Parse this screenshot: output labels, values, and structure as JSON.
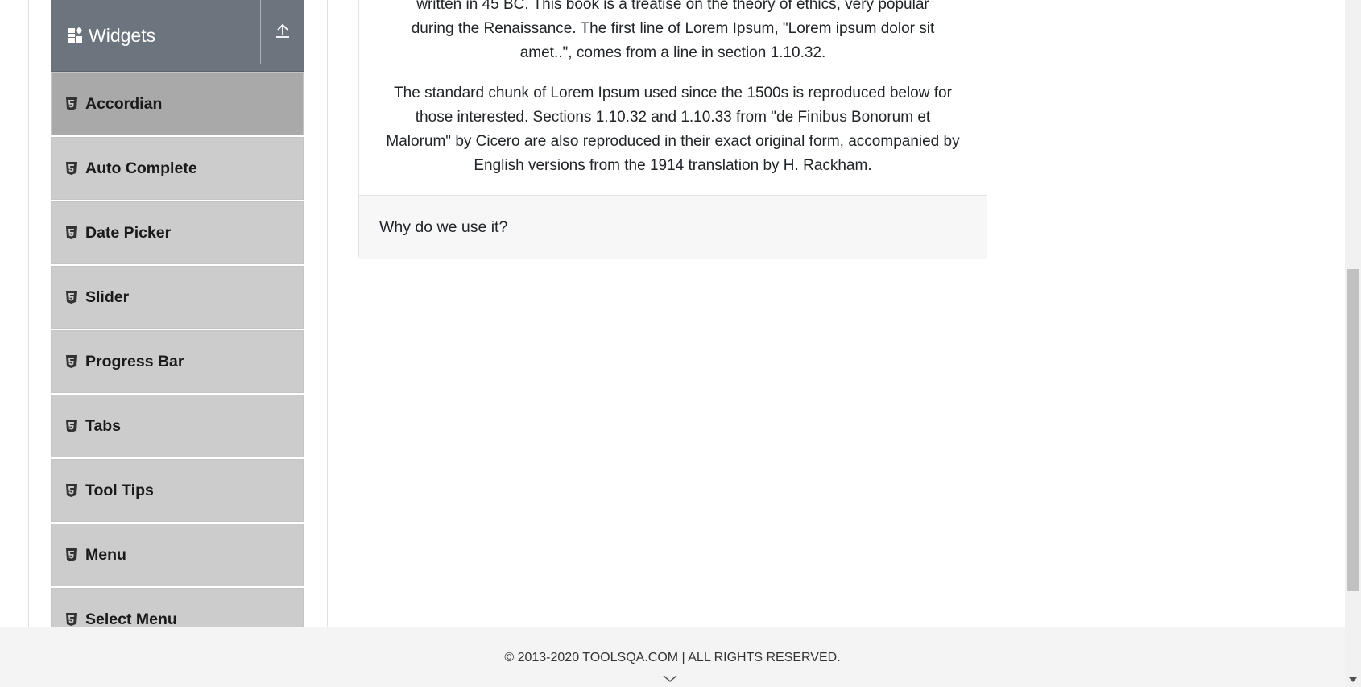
{
  "sidebar": {
    "group_title": "Widgets",
    "group_icon": "widgets-grid-icon",
    "collapse_icon": "upload-arrow-icon",
    "items": [
      {
        "label": "Accordian",
        "icon": "html5-icon",
        "active": true
      },
      {
        "label": "Auto Complete",
        "icon": "html5-icon",
        "active": false
      },
      {
        "label": "Date Picker",
        "icon": "html5-icon",
        "active": false
      },
      {
        "label": "Slider",
        "icon": "html5-icon",
        "active": false
      },
      {
        "label": "Progress Bar",
        "icon": "html5-icon",
        "active": false
      },
      {
        "label": "Tabs",
        "icon": "html5-icon",
        "active": false
      },
      {
        "label": "Tool Tips",
        "icon": "html5-icon",
        "active": false
      },
      {
        "label": "Menu",
        "icon": "html5-icon",
        "active": false
      },
      {
        "label": "Select Menu",
        "icon": "html5-icon",
        "active": false
      }
    ]
  },
  "accordion": {
    "paragraph_1_lines": [
      "written in 45 BC. This book is a treatise on the theory of ethics, very popular",
      "during the Renaissance. The first line of Lorem Ipsum, \"Lorem ipsum dolor sit",
      "amet..\", comes from a line in section 1.10.32."
    ],
    "paragraph_2": "The standard chunk of Lorem Ipsum used since the 1500s is reproduced below for those interested. Sections 1.10.32 and 1.10.33 from \"de Finibus Bonorum et Malorum\" by Cicero are also reproduced in their exact original form, accompanied by English versions from the 1914 translation by H. Rackham.",
    "next_section_title": "Why do we use it?"
  },
  "footer": {
    "copyright": "© 2013-2020 TOOLSQA.COM | ALL RIGHTS RESERVED.",
    "chevron_icon": "chevron-down-icon"
  },
  "colors": {
    "group_header_bg": "#6c757d",
    "menu_item_bg": "#cccccc",
    "menu_item_active_bg": "#a9a9a9",
    "footer_bg": "#f4f4f4"
  }
}
